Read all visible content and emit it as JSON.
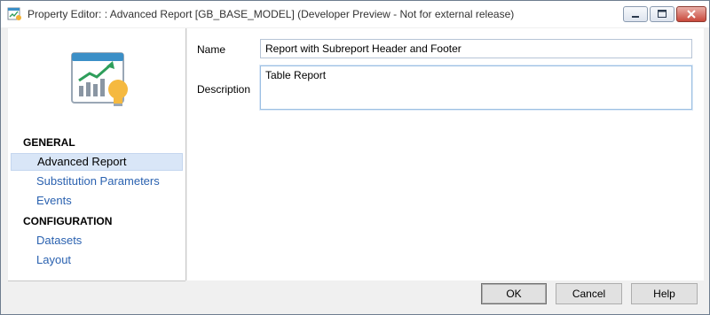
{
  "window": {
    "title": "Property Editor: : Advanced Report [GB_BASE_MODEL] (Developer Preview - Not for external release)"
  },
  "sidebar": {
    "sections": [
      {
        "title": "GENERAL",
        "items": [
          "Advanced Report",
          "Substitution Parameters",
          "Events"
        ]
      },
      {
        "title": "CONFIGURATION",
        "items": [
          "Datasets",
          "Layout"
        ]
      }
    ],
    "selected_item": "Advanced Report"
  },
  "form": {
    "name_label": "Name",
    "name_value": "Report with Subreport Header and Footer",
    "description_label": "Description",
    "description_value": "Table Report"
  },
  "footer": {
    "ok_label": "OK",
    "cancel_label": "Cancel",
    "help_label": "Help"
  },
  "colors": {
    "nav_link": "#2b62b0",
    "selected_bg": "#d9e6f7",
    "close_button": "#c9483b"
  }
}
